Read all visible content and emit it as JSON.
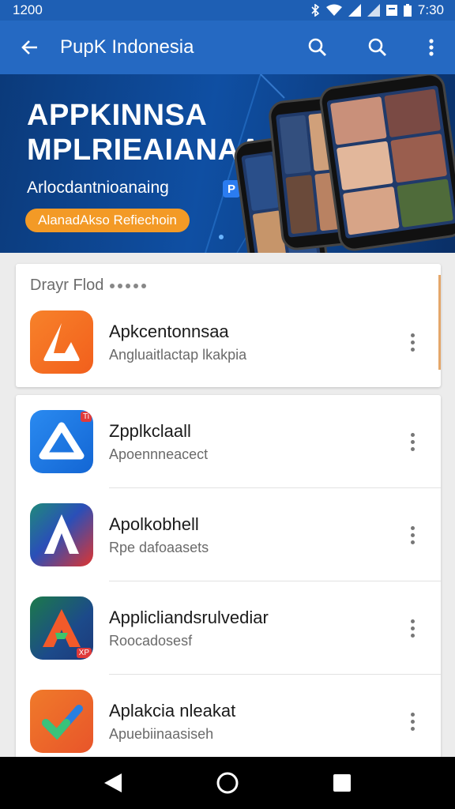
{
  "status_bar": {
    "time_left": "1200",
    "time_right": "7:30"
  },
  "app_bar": {
    "title": "PupK Indonesia"
  },
  "banner": {
    "headline": "APPKINNSA\nMPLRIEAIANAA",
    "subtitle": "Arlocdantnioanaing",
    "cta_label": "AlanadAkso Refiechoin"
  },
  "featured_card": {
    "header": "Drayr Flod",
    "app": {
      "name": "Apkcentonnsaa",
      "description": "Angluaitlactap lkakpia"
    }
  },
  "app_list": [
    {
      "name": "Zpplkclaall",
      "description": "Apoennneacect",
      "badge": "Ti"
    },
    {
      "name": "Apolkobhell",
      "description": "Rpe dafoaasets",
      "badge": ""
    },
    {
      "name": "Applicliandsrulvediar",
      "description": "Roocadosesf",
      "badge": "XP"
    },
    {
      "name": "Aplakcia nleakat",
      "description": "Apuebiinaasiseh",
      "badge": ""
    }
  ],
  "colors": {
    "status_bar": "#1e5fb4",
    "app_bar": "#2569c2",
    "cta": "#f39a26",
    "nav_bar": "#000000"
  }
}
